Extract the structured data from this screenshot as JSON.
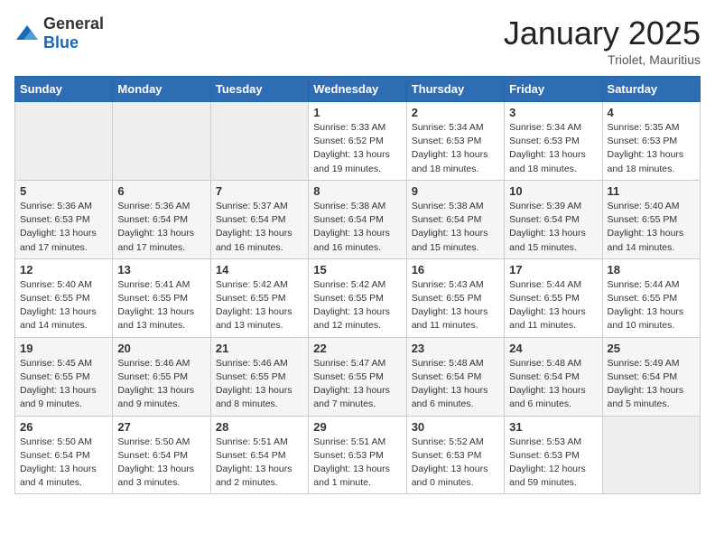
{
  "header": {
    "logo_general": "General",
    "logo_blue": "Blue",
    "month": "January 2025",
    "location": "Triolet, Mauritius"
  },
  "weekdays": [
    "Sunday",
    "Monday",
    "Tuesday",
    "Wednesday",
    "Thursday",
    "Friday",
    "Saturday"
  ],
  "weeks": [
    [
      {
        "day": "",
        "info": ""
      },
      {
        "day": "",
        "info": ""
      },
      {
        "day": "",
        "info": ""
      },
      {
        "day": "1",
        "info": "Sunrise: 5:33 AM\nSunset: 6:52 PM\nDaylight: 13 hours\nand 19 minutes."
      },
      {
        "day": "2",
        "info": "Sunrise: 5:34 AM\nSunset: 6:53 PM\nDaylight: 13 hours\nand 18 minutes."
      },
      {
        "day": "3",
        "info": "Sunrise: 5:34 AM\nSunset: 6:53 PM\nDaylight: 13 hours\nand 18 minutes."
      },
      {
        "day": "4",
        "info": "Sunrise: 5:35 AM\nSunset: 6:53 PM\nDaylight: 13 hours\nand 18 minutes."
      }
    ],
    [
      {
        "day": "5",
        "info": "Sunrise: 5:36 AM\nSunset: 6:53 PM\nDaylight: 13 hours\nand 17 minutes."
      },
      {
        "day": "6",
        "info": "Sunrise: 5:36 AM\nSunset: 6:54 PM\nDaylight: 13 hours\nand 17 minutes."
      },
      {
        "day": "7",
        "info": "Sunrise: 5:37 AM\nSunset: 6:54 PM\nDaylight: 13 hours\nand 16 minutes."
      },
      {
        "day": "8",
        "info": "Sunrise: 5:38 AM\nSunset: 6:54 PM\nDaylight: 13 hours\nand 16 minutes."
      },
      {
        "day": "9",
        "info": "Sunrise: 5:38 AM\nSunset: 6:54 PM\nDaylight: 13 hours\nand 15 minutes."
      },
      {
        "day": "10",
        "info": "Sunrise: 5:39 AM\nSunset: 6:54 PM\nDaylight: 13 hours\nand 15 minutes."
      },
      {
        "day": "11",
        "info": "Sunrise: 5:40 AM\nSunset: 6:55 PM\nDaylight: 13 hours\nand 14 minutes."
      }
    ],
    [
      {
        "day": "12",
        "info": "Sunrise: 5:40 AM\nSunset: 6:55 PM\nDaylight: 13 hours\nand 14 minutes."
      },
      {
        "day": "13",
        "info": "Sunrise: 5:41 AM\nSunset: 6:55 PM\nDaylight: 13 hours\nand 13 minutes."
      },
      {
        "day": "14",
        "info": "Sunrise: 5:42 AM\nSunset: 6:55 PM\nDaylight: 13 hours\nand 13 minutes."
      },
      {
        "day": "15",
        "info": "Sunrise: 5:42 AM\nSunset: 6:55 PM\nDaylight: 13 hours\nand 12 minutes."
      },
      {
        "day": "16",
        "info": "Sunrise: 5:43 AM\nSunset: 6:55 PM\nDaylight: 13 hours\nand 11 minutes."
      },
      {
        "day": "17",
        "info": "Sunrise: 5:44 AM\nSunset: 6:55 PM\nDaylight: 13 hours\nand 11 minutes."
      },
      {
        "day": "18",
        "info": "Sunrise: 5:44 AM\nSunset: 6:55 PM\nDaylight: 13 hours\nand 10 minutes."
      }
    ],
    [
      {
        "day": "19",
        "info": "Sunrise: 5:45 AM\nSunset: 6:55 PM\nDaylight: 13 hours\nand 9 minutes."
      },
      {
        "day": "20",
        "info": "Sunrise: 5:46 AM\nSunset: 6:55 PM\nDaylight: 13 hours\nand 9 minutes."
      },
      {
        "day": "21",
        "info": "Sunrise: 5:46 AM\nSunset: 6:55 PM\nDaylight: 13 hours\nand 8 minutes."
      },
      {
        "day": "22",
        "info": "Sunrise: 5:47 AM\nSunset: 6:55 PM\nDaylight: 13 hours\nand 7 minutes."
      },
      {
        "day": "23",
        "info": "Sunrise: 5:48 AM\nSunset: 6:54 PM\nDaylight: 13 hours\nand 6 minutes."
      },
      {
        "day": "24",
        "info": "Sunrise: 5:48 AM\nSunset: 6:54 PM\nDaylight: 13 hours\nand 6 minutes."
      },
      {
        "day": "25",
        "info": "Sunrise: 5:49 AM\nSunset: 6:54 PM\nDaylight: 13 hours\nand 5 minutes."
      }
    ],
    [
      {
        "day": "26",
        "info": "Sunrise: 5:50 AM\nSunset: 6:54 PM\nDaylight: 13 hours\nand 4 minutes."
      },
      {
        "day": "27",
        "info": "Sunrise: 5:50 AM\nSunset: 6:54 PM\nDaylight: 13 hours\nand 3 minutes."
      },
      {
        "day": "28",
        "info": "Sunrise: 5:51 AM\nSunset: 6:54 PM\nDaylight: 13 hours\nand 2 minutes."
      },
      {
        "day": "29",
        "info": "Sunrise: 5:51 AM\nSunset: 6:53 PM\nDaylight: 13 hours\nand 1 minute."
      },
      {
        "day": "30",
        "info": "Sunrise: 5:52 AM\nSunset: 6:53 PM\nDaylight: 13 hours\nand 0 minutes."
      },
      {
        "day": "31",
        "info": "Sunrise: 5:53 AM\nSunset: 6:53 PM\nDaylight: 12 hours\nand 59 minutes."
      },
      {
        "day": "",
        "info": ""
      }
    ]
  ]
}
